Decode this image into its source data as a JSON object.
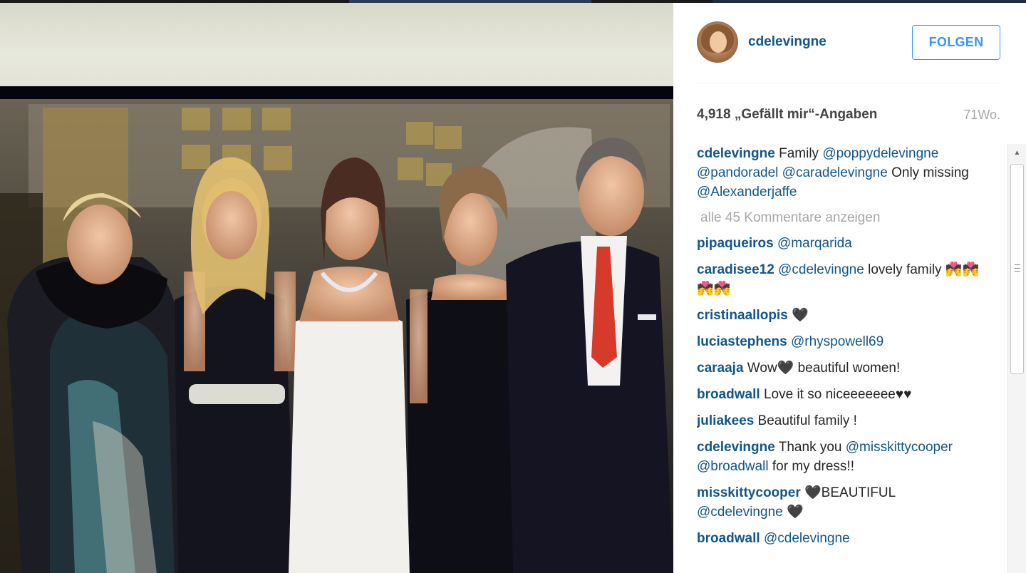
{
  "post": {
    "username": "cdelevingne",
    "follow_label": "FOLGEN",
    "likes": "4,918 „Gefällt mir“-Angaben",
    "age": "71Wo.",
    "photo_icon": "group-photo"
  },
  "comments": {
    "caption": {
      "user": "cdelevingne",
      "parts": [
        {
          "type": "text",
          "text": " Family "
        },
        {
          "type": "mention",
          "text": "@poppydelevingne"
        },
        {
          "type": "text",
          "text": " "
        },
        {
          "type": "mention",
          "text": "@pandoradel"
        },
        {
          "type": "text",
          "text": " "
        },
        {
          "type": "mention",
          "text": "@caradelevingne"
        },
        {
          "type": "text",
          "text": " Only missing "
        },
        {
          "type": "mention",
          "text": "@Alexanderjaffe"
        }
      ]
    },
    "more_label": "alle 45 Kommentare anzeigen",
    "items": [
      {
        "user": "pipaqueiros",
        "parts": [
          {
            "type": "text",
            "text": " "
          },
          {
            "type": "mention",
            "text": "@marqarida"
          }
        ]
      },
      {
        "user": "caradisee12",
        "parts": [
          {
            "type": "text",
            "text": " "
          },
          {
            "type": "mention",
            "text": "@cdelevingne"
          },
          {
            "type": "text",
            "text": " lovely family 💏💏💏💏"
          }
        ]
      },
      {
        "user": "cristinaallopis",
        "parts": [
          {
            "type": "text",
            "text": " 🖤"
          }
        ]
      },
      {
        "user": "luciastephens",
        "parts": [
          {
            "type": "text",
            "text": " "
          },
          {
            "type": "mention",
            "text": "@rhyspowell69"
          }
        ]
      },
      {
        "user": "caraaja",
        "parts": [
          {
            "type": "text",
            "text": " Wow🖤 beautiful women!"
          }
        ]
      },
      {
        "user": "broadwall",
        "parts": [
          {
            "type": "text",
            "text": " Love it so niceeeeeee♥♥"
          }
        ]
      },
      {
        "user": "juliakees",
        "parts": [
          {
            "type": "text",
            "text": " Beautiful family !"
          }
        ]
      },
      {
        "user": "cdelevingne",
        "parts": [
          {
            "type": "text",
            "text": " Thank you "
          },
          {
            "type": "mention",
            "text": "@misskittycooper"
          },
          {
            "type": "text",
            "text": " "
          },
          {
            "type": "mention",
            "text": "@broadwall"
          },
          {
            "type": "text",
            "text": " for my dress!!"
          }
        ]
      },
      {
        "user": "misskittycooper",
        "parts": [
          {
            "type": "text",
            "text": " 🖤BEAUTIFUL "
          },
          {
            "type": "mention",
            "text": "@cdelevingne"
          },
          {
            "type": "text",
            "text": " 🖤"
          }
        ]
      },
      {
        "user": "broadwall",
        "parts": [
          {
            "type": "text",
            "text": " "
          },
          {
            "type": "mention",
            "text": "@cdelevingne"
          }
        ]
      }
    ]
  },
  "colors": {
    "username_blue": "#125688",
    "follow_blue": "#3897f0",
    "muted_gray": "#a5a7aa"
  }
}
